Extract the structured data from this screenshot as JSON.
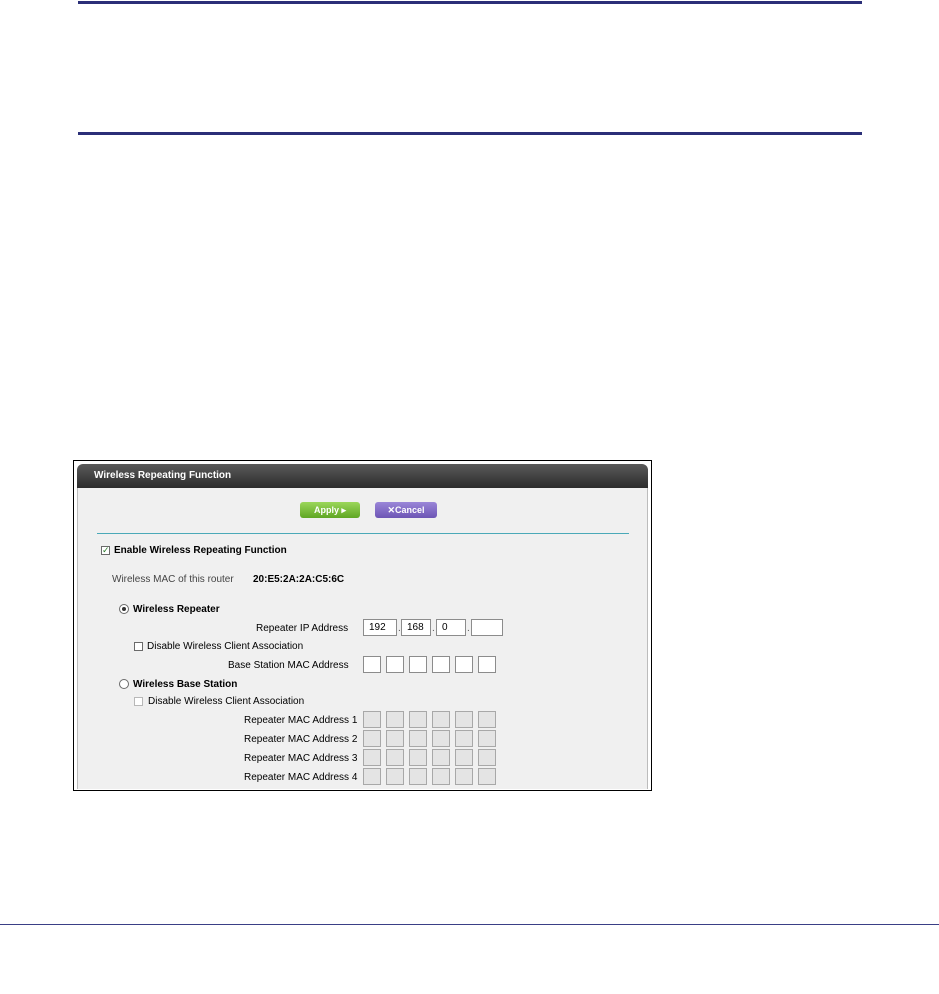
{
  "panel": {
    "title": "Wireless Repeating Function",
    "apply_label": "Apply ▸",
    "cancel_label": "✕Cancel",
    "enable_label": "Enable Wireless Repeating Function",
    "enable_checked": true,
    "mac_label": "Wireless MAC of this router",
    "mac_value": "20:E5:2A:2A:C5:6C",
    "repeater": {
      "label": "Wireless Repeater",
      "selected": true,
      "ip_label": "Repeater IP Address",
      "ip": [
        "192",
        "168",
        "0",
        ""
      ],
      "disable_label": "Disable Wireless Client Association",
      "base_mac_label": "Base Station MAC Address"
    },
    "base_station": {
      "label": "Wireless Base Station",
      "selected": false,
      "disable_label": "Disable Wireless Client Association",
      "repeater_mac_labels": [
        "Repeater MAC Address 1",
        "Repeater MAC Address 2",
        "Repeater MAC Address 3",
        "Repeater MAC Address 4"
      ]
    },
    "colors": {
      "accent_rule": "#2b2f78",
      "apply_green": "#6fb52e",
      "cancel_purple": "#7a64c2"
    }
  }
}
